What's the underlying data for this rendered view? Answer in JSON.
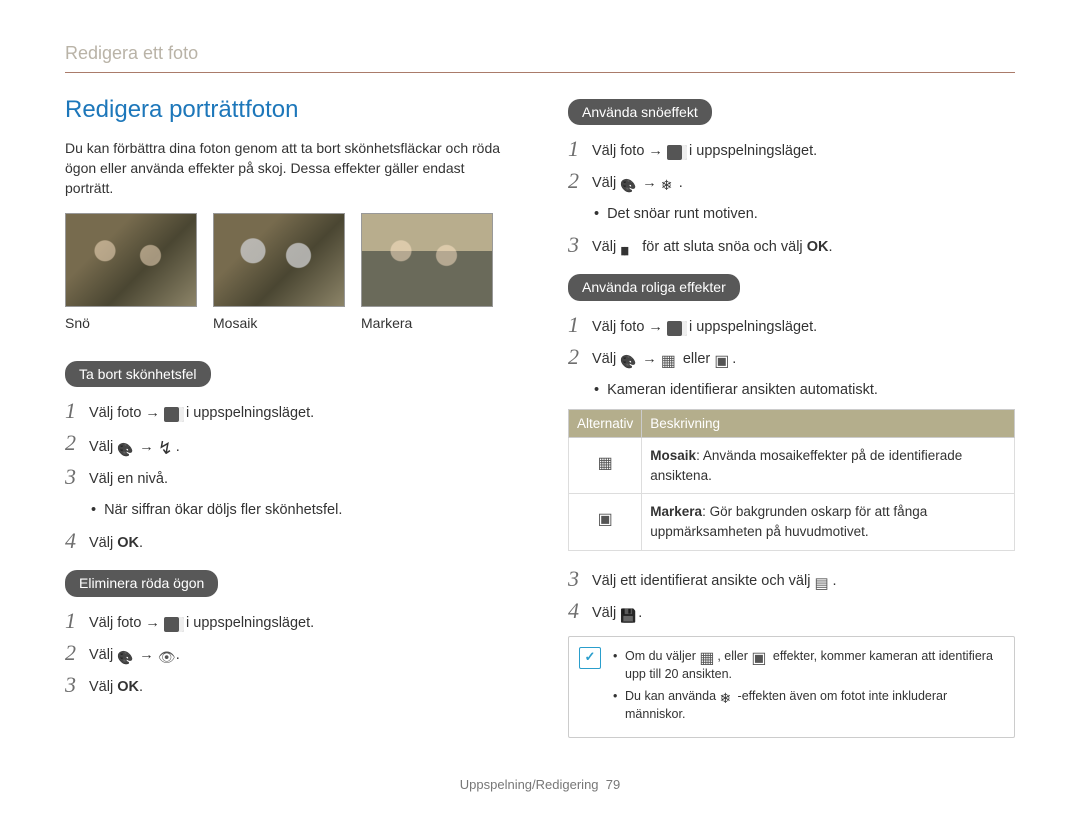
{
  "header": "Redigera ett foto",
  "left": {
    "title": "Redigera porträttfoton",
    "intro": "Du kan förbättra dina foton genom att ta bort skönhetsfläckar och röda ögon eller använda effekter på skoj. Dessa effekter gäller endast porträtt.",
    "img_labels": [
      "Snö",
      "Mosaik",
      "Markera"
    ],
    "pill1": "Ta bort skönhetsfel",
    "steps1": {
      "s1a": "Välj foto",
      "s1b": "i uppspelningsläget.",
      "s2a": "Välj",
      "s2b": ".",
      "s3": "Välj en nivå.",
      "sub3": "När siffran ökar döljs fler skönhetsfel.",
      "s4a": "Välj",
      "s4b": "."
    },
    "pill2": "Eliminera röda ögon",
    "steps2": {
      "s1a": "Välj foto",
      "s1b": "i uppspelningsläget.",
      "s2a": "Välj",
      "s2b": ".",
      "s3a": "Välj",
      "s3b": "."
    }
  },
  "right": {
    "pill1": "Använda snöeffekt",
    "snow": {
      "s1a": "Välj foto",
      "s1b": "i uppspelningsläget.",
      "s2a": "Välj",
      "s2b": ".",
      "sub2": "Det snöar runt motiven.",
      "s3a": "Välj",
      "s3b": "för att sluta snöa och välj",
      "s3c": "."
    },
    "pill2": "Använda roliga effekter",
    "fun": {
      "s1a": "Välj foto",
      "s1b": "i uppspelningsläget.",
      "s2a": "Välj",
      "s2mid": "eller",
      "s2b": ".",
      "sub2": "Kameran identifierar ansikten automatiskt.",
      "th1": "Alternativ",
      "th2": "Beskrivning",
      "row1_name": "Mosaik",
      "row1_text": ": Använda mosaikeffekter på de identifierade ansiktena.",
      "row2_name": "Markera",
      "row2_text": ": Gör bakgrunden oskarp för att fånga uppmärksamheten på huvudmotivet.",
      "s3a": "Välj ett identifierat ansikte och välj",
      "s3b": ".",
      "s4a": "Välj",
      "s4b": "."
    },
    "info": {
      "l1a": "Om du väljer",
      "l1b": ", eller",
      "l1c": "effekter, kommer kameran att identifiera upp till 20 ansikten.",
      "l2a": "Du kan använda",
      "l2b": "-effekten även om fotot inte inkluderar människor."
    }
  },
  "footer": {
    "section": "Uppspelning/Redigering",
    "page": "79"
  },
  "ok_label": "OK"
}
